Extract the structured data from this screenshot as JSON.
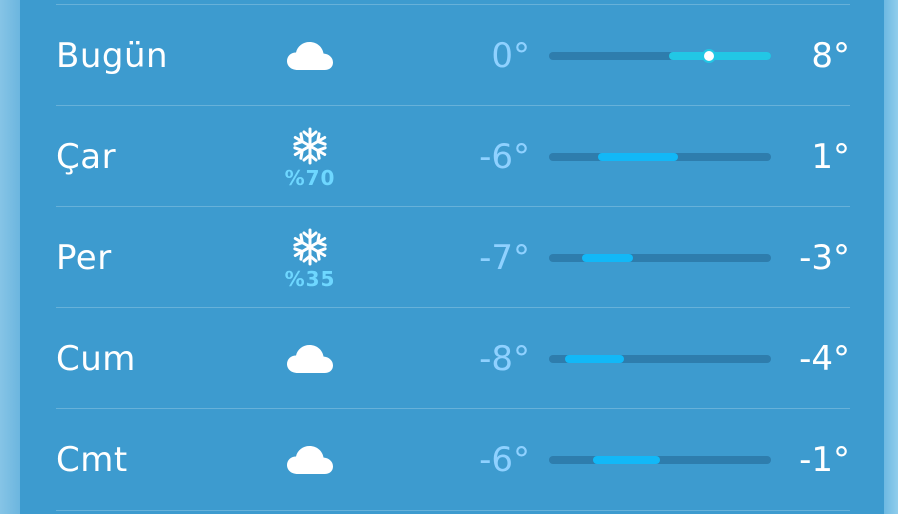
{
  "forecast": {
    "unit_symbol": "°",
    "colors": {
      "panel_bg": "#3d9bcf",
      "day_text": "#ffffff",
      "low_text": "#8fd1ff",
      "precip_text": "#6ed7ff",
      "bar_fill": "#12b8f7",
      "bar_fill_today": "#22c7e5"
    },
    "days": [
      {
        "day": "Bugün",
        "icon": "cloud-icon",
        "precip": "",
        "low": "0°",
        "high": "8°",
        "bar_start": 0.54,
        "bar_end": 1.0,
        "current": 0.72
      },
      {
        "day": "Çar",
        "icon": "snowflake-icon",
        "precip": "%70",
        "low": "-6°",
        "high": "1°",
        "bar_start": 0.22,
        "bar_end": 0.58,
        "current": null
      },
      {
        "day": "Per",
        "icon": "snowflake-icon",
        "precip": "%35",
        "low": "-7°",
        "high": "-3°",
        "bar_start": 0.15,
        "bar_end": 0.38,
        "current": null
      },
      {
        "day": "Cum",
        "icon": "cloud-icon",
        "precip": "",
        "low": "-8°",
        "high": "-4°",
        "bar_start": 0.07,
        "bar_end": 0.34,
        "current": null
      },
      {
        "day": "Cmt",
        "icon": "cloud-icon",
        "precip": "",
        "low": "-6°",
        "high": "-1°",
        "bar_start": 0.2,
        "bar_end": 0.5,
        "current": null
      }
    ]
  }
}
